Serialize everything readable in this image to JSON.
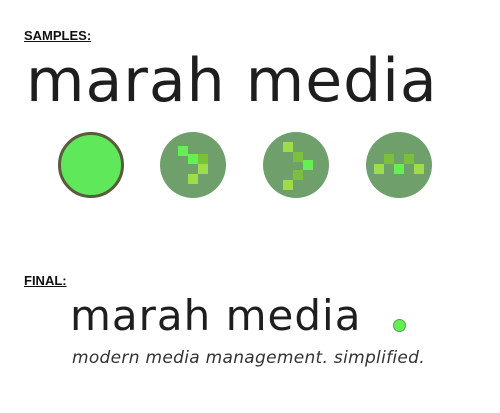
{
  "samples": {
    "label": "SAMPLES:",
    "wordmark": "marah media",
    "icons": [
      {
        "name": "solid-circle-icon"
      },
      {
        "name": "pixel-chevron-icon"
      },
      {
        "name": "pixel-chevron-alt-icon"
      },
      {
        "name": "pixel-wave-icon"
      }
    ]
  },
  "final": {
    "label": "FINAL:",
    "wordmark": "marah media",
    "tagline": "modern media management. simplified."
  },
  "colors": {
    "accent_green": "#5ee85a",
    "icon_bg": "#6f9f6a",
    "pixel_light": "#9fdc4a",
    "pixel_bright": "#66ee55",
    "pixel_dark": "#7cbf3a",
    "text": "#1e1e1e"
  }
}
